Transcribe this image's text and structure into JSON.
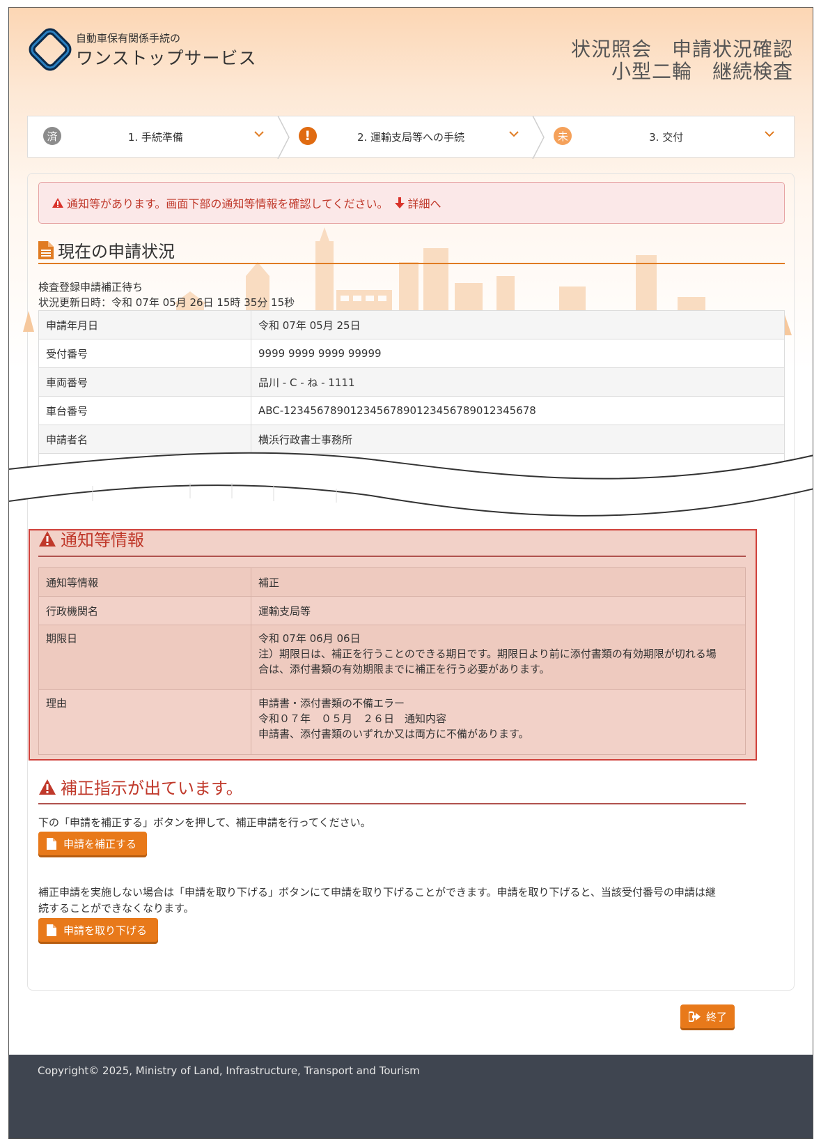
{
  "header": {
    "brand_sub": "自動車保有関係手続の",
    "brand_main": "ワンストップサービス",
    "title_line1": "状況照会　申請状況確認",
    "title_line2": "小型二輪　継続検査"
  },
  "stepper": {
    "steps": [
      {
        "badge": "済",
        "label": "1. 手続準備",
        "state": "done"
      },
      {
        "badge": "!",
        "label": "2. 運輸支局等への手続",
        "state": "warn"
      },
      {
        "badge": "未",
        "label": "3. 交付",
        "state": "todo"
      }
    ]
  },
  "alert": {
    "message": "通知等があります。画面下部の通知等情報を確認してください。",
    "link": "詳細へ"
  },
  "current": {
    "title": "現在の申請状況",
    "status": "検査登録申請補正待ち",
    "updated": "状況更新日時：令和 07年 05月 26日 15時 35分 15秒",
    "rows": [
      {
        "k": "申請年月日",
        "v": "令和 07年 05月 25日"
      },
      {
        "k": "受付番号",
        "v": "9999 9999 9999 99999"
      },
      {
        "k": "車両番号",
        "v": "品川 - C - ね - 1111"
      },
      {
        "k": "車台番号",
        "v": "ABC-12345678901234567890123456789012345678"
      },
      {
        "k": "申請者名",
        "v": "横浜行政書士事務所"
      }
    ]
  },
  "notice": {
    "title": "通知等情報",
    "rows": [
      {
        "k": "通知等情報",
        "v": [
          "補正"
        ]
      },
      {
        "k": "行政機関名",
        "v": [
          "運輸支局等"
        ]
      },
      {
        "k": "期限日",
        "v": [
          "令和 07年 06月 06日",
          "注）期限日は、補正を行うことのできる期日です。期限日より前に添付書類の有効期限が切れる場",
          "合は、添付書類の有効期限までに補正を行う必要があります。"
        ]
      },
      {
        "k": "理由",
        "v": [
          "申請書・添付書類の不備エラー",
          "令和０７年　０５月　２６日　通知内容",
          "申請書、添付書類のいずれか又は両方に不備があります。"
        ]
      }
    ]
  },
  "hosei": {
    "title": "補正指示が出ています。",
    "instruction": "下の「申請を補正する」ボタンを押して、補正申請を行ってください。",
    "correct_button": "申請を補正する",
    "withdraw_text_1": "補正申請を実施しない場合は「申請を取り下げる」ボタンにて申請を取り下げることができます。申請を取り下げると、当該受付番号の申請は継",
    "withdraw_text_2": "続することができなくなります。",
    "withdraw_button": "申請を取り下げる"
  },
  "exit_button": "終了",
  "footer": {
    "copyright": "Copyright© 2025, Ministry of Land, Infrastructure, Transport and Tourism"
  },
  "colors": {
    "accent": "#e8791a",
    "danger": "#c0392b",
    "notice_bg": "#f2d1c8",
    "footer_bg": "#3f4550"
  }
}
